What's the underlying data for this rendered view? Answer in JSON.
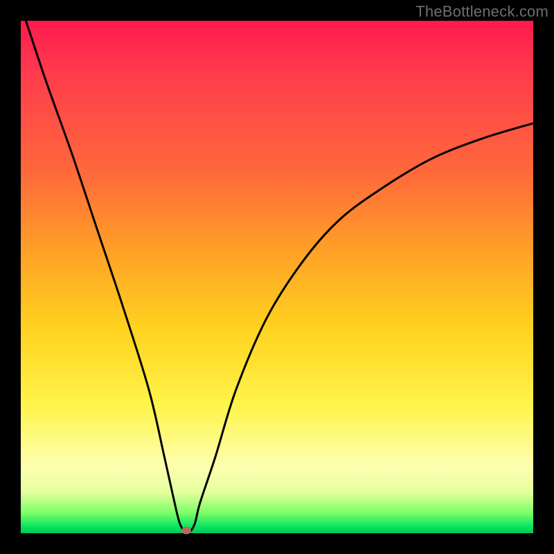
{
  "watermark": "TheBottleneck.com",
  "chart_data": {
    "type": "line",
    "title": "",
    "xlabel": "",
    "ylabel": "",
    "xlim": [
      0,
      100
    ],
    "ylim": [
      0,
      100
    ],
    "grid": false,
    "legend": false,
    "series": [
      {
        "name": "bottleneck-curve",
        "x": [
          1,
          5,
          10,
          15,
          20,
          25,
          28,
          30,
          31,
          32,
          33,
          34,
          35,
          38,
          42,
          48,
          55,
          62,
          70,
          80,
          90,
          100
        ],
        "values": [
          100,
          88,
          74,
          59,
          44,
          28,
          15,
          6,
          2,
          0.3,
          0.3,
          2,
          6,
          15,
          28,
          42,
          53,
          61,
          67,
          73,
          77,
          80
        ]
      }
    ],
    "marker": {
      "x": 32.3,
      "y": 0.5
    },
    "gradient_stops": [
      {
        "pos": 0,
        "color": "#ff1a4d"
      },
      {
        "pos": 30,
        "color": "#ff6a3a"
      },
      {
        "pos": 60,
        "color": "#ffd21f"
      },
      {
        "pos": 88,
        "color": "#fdffb0"
      },
      {
        "pos": 100,
        "color": "#00c853"
      }
    ]
  }
}
